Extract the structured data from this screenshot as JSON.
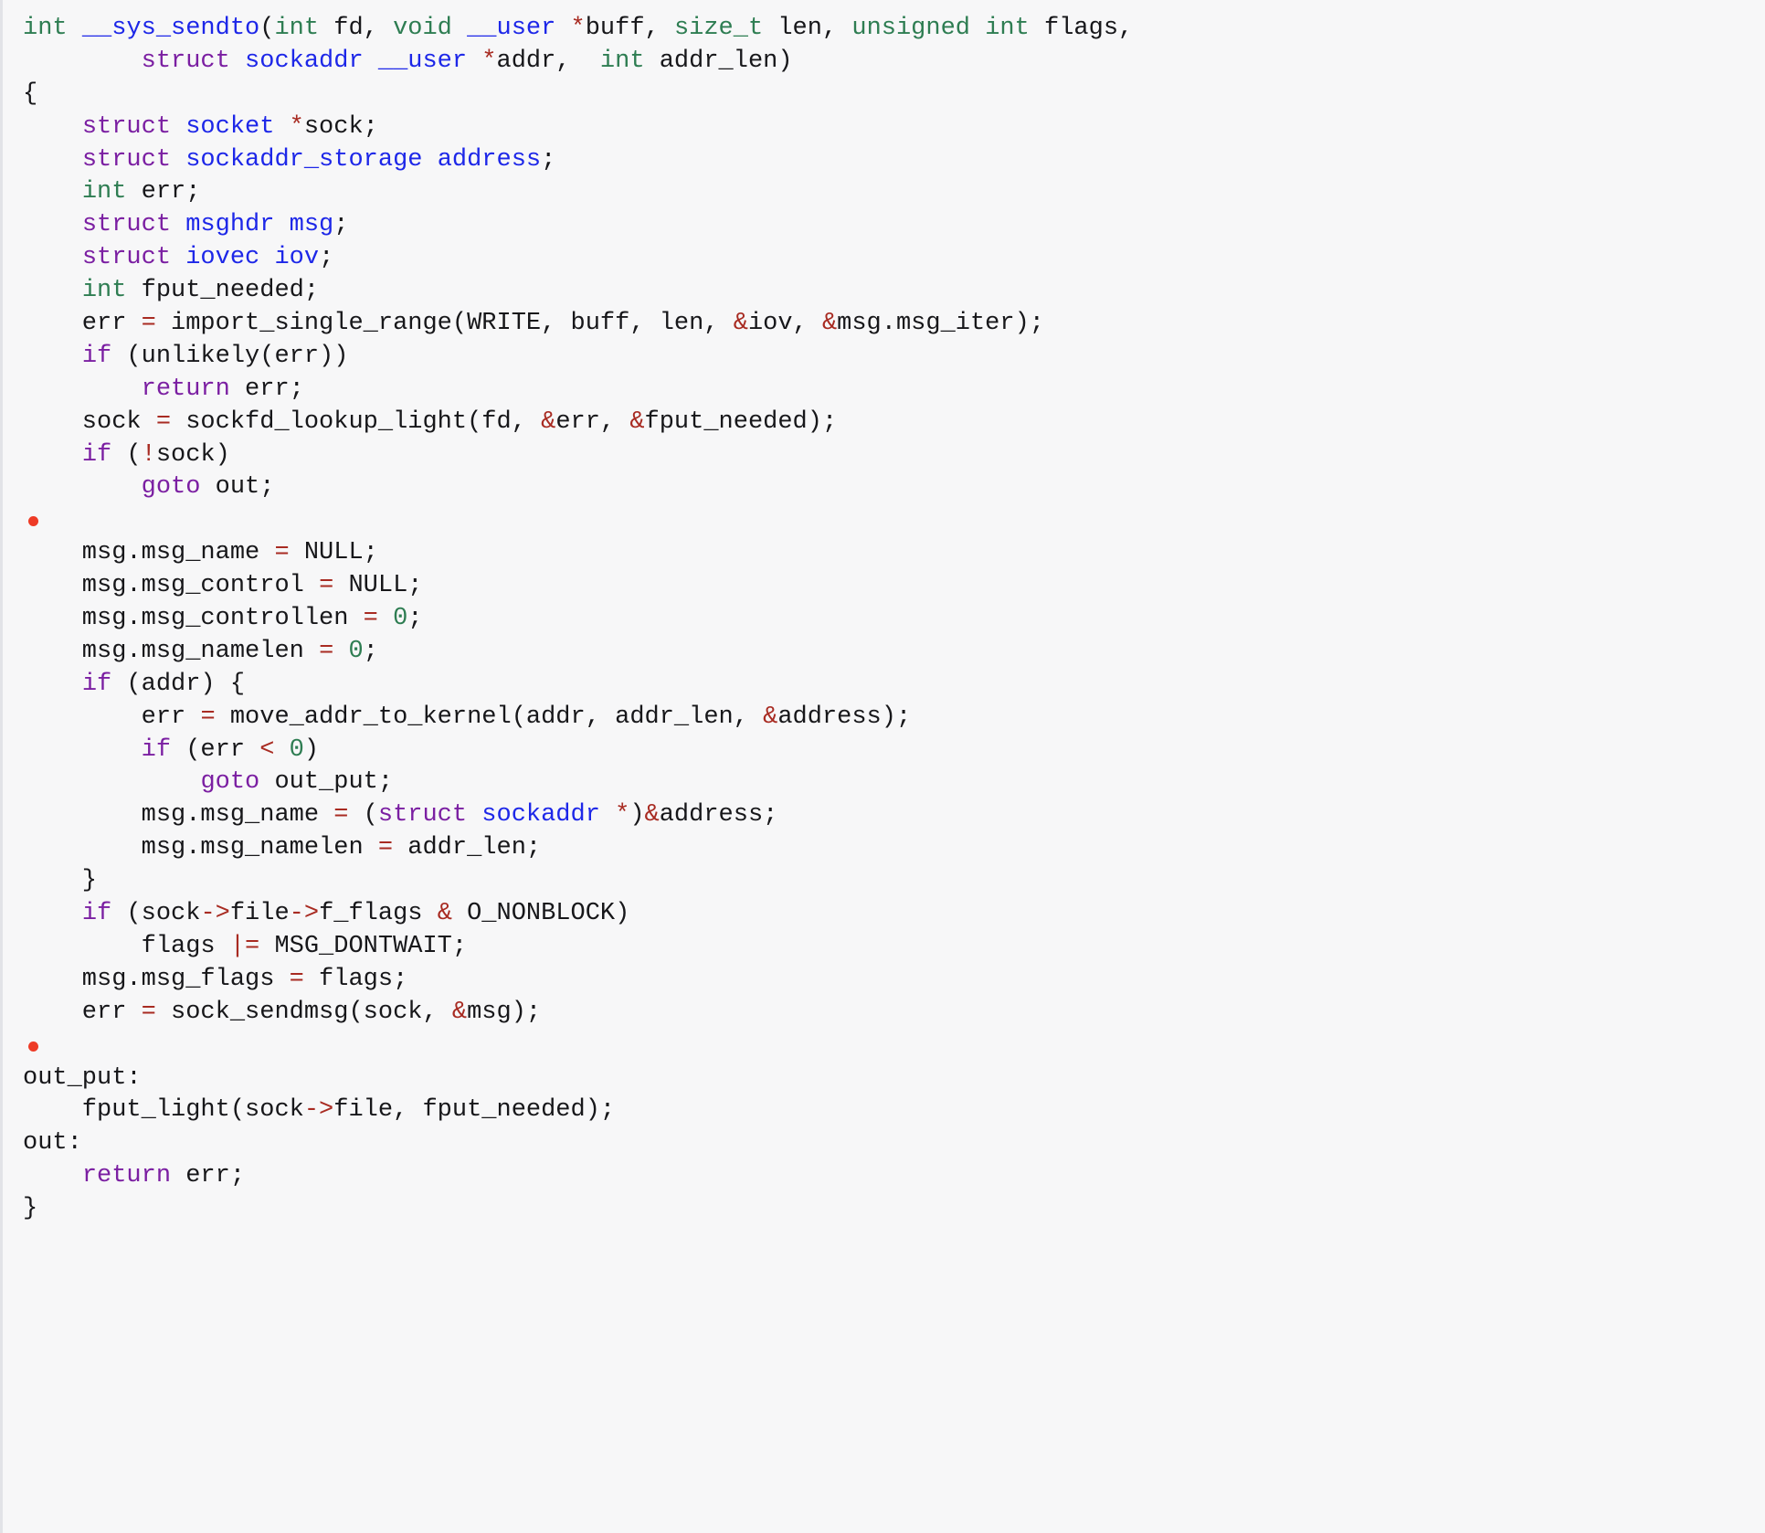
{
  "viewer": {
    "name": "code-listing",
    "language": "C",
    "background_color": "#f7f7f8",
    "left_border_color": "#e2e3e7",
    "marker_color": "#ee3b26",
    "palette": {
      "plain": "#17171a",
      "keyword": "#7b1fa2",
      "type": "#2e7d52",
      "identifier": "#1d27e8",
      "operator": "#a82b22",
      "number": "#2e7d52"
    }
  },
  "code": {
    "plain_text": "int __sys_sendto(int fd, void __user *buff, size_t len, unsigned int flags,\n        struct sockaddr __user *addr,  int addr_len)\n{\n    struct socket *sock;\n    struct sockaddr_storage address;\n    int err;\n    struct msghdr msg;\n    struct iovec iov;\n    int fput_needed;\n    err = import_single_range(WRITE, buff, len, &iov, &msg.msg_iter);\n    if (unlikely(err))\n        return err;\n    sock = sockfd_lookup_light(fd, &err, &fput_needed);\n    if (!sock)\n        goto out;\n\n    msg.msg_name = NULL;\n    msg.msg_control = NULL;\n    msg.msg_controllen = 0;\n    msg.msg_namelen = 0;\n    if (addr) {\n        err = move_addr_to_kernel(addr, addr_len, &address);\n        if (err < 0)\n            goto out_put;\n        msg.msg_name = (struct sockaddr *)&address;\n        msg.msg_namelen = addr_len;\n    }\n    if (sock->file->f_flags & O_NONBLOCK)\n        flags |= MSG_DONTWAIT;\n    msg.msg_flags = flags;\n    err = sock_sendmsg(sock, &msg);\n\nout_put:\n    fput_light(sock->file, fput_needed);\nout:\n    return err;\n}",
    "lines": [
      {
        "marker": false,
        "tokens": [
          {
            "t": "int",
            "c": "t-type"
          },
          {
            "t": " ",
            "c": "t-plain"
          },
          {
            "t": "__sys_sendto",
            "c": "t-ident"
          },
          {
            "t": "(",
            "c": "t-punct"
          },
          {
            "t": "int",
            "c": "t-type"
          },
          {
            "t": " fd, ",
            "c": "t-plain"
          },
          {
            "t": "void",
            "c": "t-type"
          },
          {
            "t": " ",
            "c": "t-plain"
          },
          {
            "t": "__user",
            "c": "t-ident"
          },
          {
            "t": " ",
            "c": "t-plain"
          },
          {
            "t": "*",
            "c": "t-op"
          },
          {
            "t": "buff, ",
            "c": "t-plain"
          },
          {
            "t": "size_t",
            "c": "t-type"
          },
          {
            "t": " len, ",
            "c": "t-plain"
          },
          {
            "t": "unsigned",
            "c": "t-type"
          },
          {
            "t": " ",
            "c": "t-plain"
          },
          {
            "t": "int",
            "c": "t-type"
          },
          {
            "t": " flags,",
            "c": "t-plain"
          }
        ]
      },
      {
        "marker": false,
        "tokens": [
          {
            "t": "        ",
            "c": "t-plain"
          },
          {
            "t": "struct",
            "c": "t-kw"
          },
          {
            "t": " ",
            "c": "t-plain"
          },
          {
            "t": "sockaddr",
            "c": "t-ident"
          },
          {
            "t": " ",
            "c": "t-plain"
          },
          {
            "t": "__user",
            "c": "t-ident"
          },
          {
            "t": " ",
            "c": "t-plain"
          },
          {
            "t": "*",
            "c": "t-op"
          },
          {
            "t": "addr,  ",
            "c": "t-plain"
          },
          {
            "t": "int",
            "c": "t-type"
          },
          {
            "t": " addr_len)",
            "c": "t-plain"
          }
        ]
      },
      {
        "marker": false,
        "tokens": [
          {
            "t": "{",
            "c": "t-punct"
          }
        ]
      },
      {
        "marker": false,
        "tokens": [
          {
            "t": "    ",
            "c": "t-plain"
          },
          {
            "t": "struct",
            "c": "t-kw"
          },
          {
            "t": " ",
            "c": "t-plain"
          },
          {
            "t": "socket",
            "c": "t-ident"
          },
          {
            "t": " ",
            "c": "t-plain"
          },
          {
            "t": "*",
            "c": "t-op"
          },
          {
            "t": "sock;",
            "c": "t-plain"
          }
        ]
      },
      {
        "marker": false,
        "tokens": [
          {
            "t": "    ",
            "c": "t-plain"
          },
          {
            "t": "struct",
            "c": "t-kw"
          },
          {
            "t": " ",
            "c": "t-plain"
          },
          {
            "t": "sockaddr_storage",
            "c": "t-ident"
          },
          {
            "t": " ",
            "c": "t-plain"
          },
          {
            "t": "address",
            "c": "t-ident"
          },
          {
            "t": ";",
            "c": "t-punct"
          }
        ]
      },
      {
        "marker": false,
        "tokens": [
          {
            "t": "    ",
            "c": "t-plain"
          },
          {
            "t": "int",
            "c": "t-type"
          },
          {
            "t": " err;",
            "c": "t-plain"
          }
        ]
      },
      {
        "marker": false,
        "tokens": [
          {
            "t": "    ",
            "c": "t-plain"
          },
          {
            "t": "struct",
            "c": "t-kw"
          },
          {
            "t": " ",
            "c": "t-plain"
          },
          {
            "t": "msghdr",
            "c": "t-ident"
          },
          {
            "t": " ",
            "c": "t-plain"
          },
          {
            "t": "msg",
            "c": "t-ident"
          },
          {
            "t": ";",
            "c": "t-punct"
          }
        ]
      },
      {
        "marker": false,
        "tokens": [
          {
            "t": "    ",
            "c": "t-plain"
          },
          {
            "t": "struct",
            "c": "t-kw"
          },
          {
            "t": " ",
            "c": "t-plain"
          },
          {
            "t": "iovec",
            "c": "t-ident"
          },
          {
            "t": " ",
            "c": "t-plain"
          },
          {
            "t": "iov",
            "c": "t-ident"
          },
          {
            "t": ";",
            "c": "t-punct"
          }
        ]
      },
      {
        "marker": false,
        "tokens": [
          {
            "t": "    ",
            "c": "t-plain"
          },
          {
            "t": "int",
            "c": "t-type"
          },
          {
            "t": " fput_needed;",
            "c": "t-plain"
          }
        ]
      },
      {
        "marker": false,
        "tokens": [
          {
            "t": "    err ",
            "c": "t-plain"
          },
          {
            "t": "=",
            "c": "t-op"
          },
          {
            "t": " import_single_range(WRITE, buff, len, ",
            "c": "t-plain"
          },
          {
            "t": "&",
            "c": "t-op"
          },
          {
            "t": "iov, ",
            "c": "t-plain"
          },
          {
            "t": "&",
            "c": "t-op"
          },
          {
            "t": "msg.msg_iter);",
            "c": "t-plain"
          }
        ]
      },
      {
        "marker": false,
        "tokens": [
          {
            "t": "    ",
            "c": "t-plain"
          },
          {
            "t": "if",
            "c": "t-kw"
          },
          {
            "t": " (unlikely(err))",
            "c": "t-plain"
          }
        ]
      },
      {
        "marker": false,
        "tokens": [
          {
            "t": "        ",
            "c": "t-plain"
          },
          {
            "t": "return",
            "c": "t-kw"
          },
          {
            "t": " err;",
            "c": "t-plain"
          }
        ]
      },
      {
        "marker": false,
        "tokens": [
          {
            "t": "    sock ",
            "c": "t-plain"
          },
          {
            "t": "=",
            "c": "t-op"
          },
          {
            "t": " sockfd_lookup_light(fd, ",
            "c": "t-plain"
          },
          {
            "t": "&",
            "c": "t-op"
          },
          {
            "t": "err, ",
            "c": "t-plain"
          },
          {
            "t": "&",
            "c": "t-op"
          },
          {
            "t": "fput_needed);",
            "c": "t-plain"
          }
        ]
      },
      {
        "marker": false,
        "tokens": [
          {
            "t": "    ",
            "c": "t-plain"
          },
          {
            "t": "if",
            "c": "t-kw"
          },
          {
            "t": " (",
            "c": "t-plain"
          },
          {
            "t": "!",
            "c": "t-op"
          },
          {
            "t": "sock)",
            "c": "t-plain"
          }
        ]
      },
      {
        "marker": false,
        "tokens": [
          {
            "t": "        ",
            "c": "t-plain"
          },
          {
            "t": "goto",
            "c": "t-kw"
          },
          {
            "t": " out;",
            "c": "t-plain"
          }
        ]
      },
      {
        "marker": true,
        "tokens": []
      },
      {
        "marker": false,
        "tokens": [
          {
            "t": "    msg.msg_name ",
            "c": "t-plain"
          },
          {
            "t": "=",
            "c": "t-op"
          },
          {
            "t": " NULL;",
            "c": "t-plain"
          }
        ]
      },
      {
        "marker": false,
        "tokens": [
          {
            "t": "    msg.msg_control ",
            "c": "t-plain"
          },
          {
            "t": "=",
            "c": "t-op"
          },
          {
            "t": " NULL;",
            "c": "t-plain"
          }
        ]
      },
      {
        "marker": false,
        "tokens": [
          {
            "t": "    msg.msg_controllen ",
            "c": "t-plain"
          },
          {
            "t": "=",
            "c": "t-op"
          },
          {
            "t": " ",
            "c": "t-plain"
          },
          {
            "t": "0",
            "c": "t-num"
          },
          {
            "t": ";",
            "c": "t-punct"
          }
        ]
      },
      {
        "marker": false,
        "tokens": [
          {
            "t": "    msg.msg_namelen ",
            "c": "t-plain"
          },
          {
            "t": "=",
            "c": "t-op"
          },
          {
            "t": " ",
            "c": "t-plain"
          },
          {
            "t": "0",
            "c": "t-num"
          },
          {
            "t": ";",
            "c": "t-punct"
          }
        ]
      },
      {
        "marker": false,
        "tokens": [
          {
            "t": "    ",
            "c": "t-plain"
          },
          {
            "t": "if",
            "c": "t-kw"
          },
          {
            "t": " (addr) {",
            "c": "t-plain"
          }
        ]
      },
      {
        "marker": false,
        "tokens": [
          {
            "t": "        err ",
            "c": "t-plain"
          },
          {
            "t": "=",
            "c": "t-op"
          },
          {
            "t": " move_addr_to_kernel(addr, addr_len, ",
            "c": "t-plain"
          },
          {
            "t": "&",
            "c": "t-op"
          },
          {
            "t": "address);",
            "c": "t-plain"
          }
        ]
      },
      {
        "marker": false,
        "tokens": [
          {
            "t": "        ",
            "c": "t-plain"
          },
          {
            "t": "if",
            "c": "t-kw"
          },
          {
            "t": " (err ",
            "c": "t-plain"
          },
          {
            "t": "<",
            "c": "t-op"
          },
          {
            "t": " ",
            "c": "t-plain"
          },
          {
            "t": "0",
            "c": "t-num"
          },
          {
            "t": ")",
            "c": "t-punct"
          }
        ]
      },
      {
        "marker": false,
        "tokens": [
          {
            "t": "            ",
            "c": "t-plain"
          },
          {
            "t": "goto",
            "c": "t-kw"
          },
          {
            "t": " out_put;",
            "c": "t-plain"
          }
        ]
      },
      {
        "marker": false,
        "tokens": [
          {
            "t": "        msg.msg_name ",
            "c": "t-plain"
          },
          {
            "t": "=",
            "c": "t-op"
          },
          {
            "t": " (",
            "c": "t-plain"
          },
          {
            "t": "struct",
            "c": "t-kw"
          },
          {
            "t": " ",
            "c": "t-plain"
          },
          {
            "t": "sockaddr",
            "c": "t-ident"
          },
          {
            "t": " ",
            "c": "t-plain"
          },
          {
            "t": "*",
            "c": "t-op"
          },
          {
            "t": ")",
            "c": "t-punct"
          },
          {
            "t": "&",
            "c": "t-op"
          },
          {
            "t": "address;",
            "c": "t-plain"
          }
        ]
      },
      {
        "marker": false,
        "tokens": [
          {
            "t": "        msg.msg_namelen ",
            "c": "t-plain"
          },
          {
            "t": "=",
            "c": "t-op"
          },
          {
            "t": " addr_len;",
            "c": "t-plain"
          }
        ]
      },
      {
        "marker": false,
        "tokens": [
          {
            "t": "    }",
            "c": "t-punct"
          }
        ]
      },
      {
        "marker": false,
        "tokens": [
          {
            "t": "    ",
            "c": "t-plain"
          },
          {
            "t": "if",
            "c": "t-kw"
          },
          {
            "t": " (sock",
            "c": "t-plain"
          },
          {
            "t": "->",
            "c": "t-op"
          },
          {
            "t": "file",
            "c": "t-plain"
          },
          {
            "t": "->",
            "c": "t-op"
          },
          {
            "t": "f_flags ",
            "c": "t-plain"
          },
          {
            "t": "&",
            "c": "t-op"
          },
          {
            "t": " O_NONBLOCK)",
            "c": "t-plain"
          }
        ]
      },
      {
        "marker": false,
        "tokens": [
          {
            "t": "        flags ",
            "c": "t-plain"
          },
          {
            "t": "|=",
            "c": "t-op"
          },
          {
            "t": " MSG_DONTWAIT;",
            "c": "t-plain"
          }
        ]
      },
      {
        "marker": false,
        "tokens": [
          {
            "t": "    msg.msg_flags ",
            "c": "t-plain"
          },
          {
            "t": "=",
            "c": "t-op"
          },
          {
            "t": " flags;",
            "c": "t-plain"
          }
        ]
      },
      {
        "marker": false,
        "tokens": [
          {
            "t": "    err ",
            "c": "t-plain"
          },
          {
            "t": "=",
            "c": "t-op"
          },
          {
            "t": " sock_sendmsg(sock, ",
            "c": "t-plain"
          },
          {
            "t": "&",
            "c": "t-op"
          },
          {
            "t": "msg);",
            "c": "t-plain"
          }
        ]
      },
      {
        "marker": true,
        "tokens": []
      },
      {
        "marker": false,
        "tokens": [
          {
            "t": "out_put:",
            "c": "t-plain"
          }
        ]
      },
      {
        "marker": false,
        "tokens": [
          {
            "t": "    fput_light(sock",
            "c": "t-plain"
          },
          {
            "t": "->",
            "c": "t-op"
          },
          {
            "t": "file, fput_needed);",
            "c": "t-plain"
          }
        ]
      },
      {
        "marker": false,
        "tokens": [
          {
            "t": "out:",
            "c": "t-plain"
          }
        ]
      },
      {
        "marker": false,
        "tokens": [
          {
            "t": "    ",
            "c": "t-plain"
          },
          {
            "t": "return",
            "c": "t-kw"
          },
          {
            "t": " err;",
            "c": "t-plain"
          }
        ]
      },
      {
        "marker": false,
        "tokens": [
          {
            "t": "}",
            "c": "t-punct"
          }
        ]
      }
    ]
  }
}
